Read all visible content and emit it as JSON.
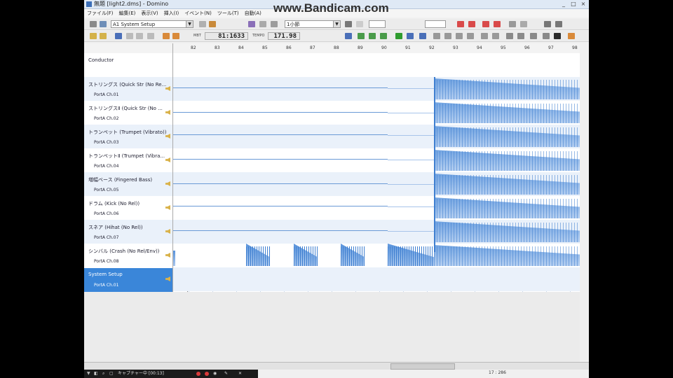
{
  "window": {
    "title": "無題 [light2.dms] - Domino",
    "watermark": "www.Bandicam.com",
    "controls": [
      "_",
      "□",
      "×"
    ]
  },
  "menu": [
    "ファイル(F)",
    "編集(E)",
    "表示(V)",
    "挿入(I)",
    "イベント(N)",
    "ツール(T)",
    "自動(A)"
  ],
  "toolbar": {
    "track_select": "A1 System Setup",
    "snap_select": "1小節",
    "position": "81:1633",
    "position_label": "MBT",
    "tempo": "171.98",
    "tempo_label": "TEMPO"
  },
  "ruler": {
    "measures": [
      "82",
      "83",
      "84",
      "85",
      "86",
      "87",
      "88",
      "89",
      "90",
      "91",
      "92",
      "93",
      "94",
      "95",
      "96",
      "97",
      "98"
    ]
  },
  "tracks": [
    {
      "name": "Conductor",
      "port": ""
    },
    {
      "name": "ストリングス (Quick Str (No Re...",
      "port": "PortA  Ch.01"
    },
    {
      "name": "ストリングスⅡ (Quick Str (No ...",
      "port": "PortA  Ch.02"
    },
    {
      "name": "トランペット (Trumpet (Vibrato))",
      "port": "PortA  Ch.03"
    },
    {
      "name": "トランペットⅡ (Trumpet (Vibra...",
      "port": "PortA  Ch.04"
    },
    {
      "name": "増幅ベース (Fingered Bass)",
      "port": "PortA  Ch.05"
    },
    {
      "name": "ドラム (Kick (No Rel))",
      "port": "PortA  Ch.06"
    },
    {
      "name": "スネア (Hihat (No Rel))",
      "port": "PortA  Ch.07"
    },
    {
      "name": "シンバル (Crash (No Rel/Env))",
      "port": "PortA  Ch.08"
    },
    {
      "name": "System Setup",
      "port": "PortA  Ch.01"
    }
  ],
  "colors": {
    "accent": "#3a86d9",
    "note": "#3f7fd0",
    "row_alt": "#eaf1fa"
  },
  "status": {
    "value": "17 : 286"
  },
  "taskbar": {
    "capture_label": "キャプチャー中 [00:13]"
  }
}
